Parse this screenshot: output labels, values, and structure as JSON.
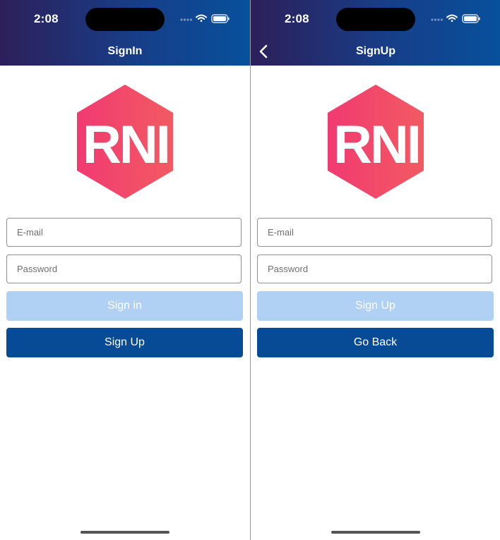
{
  "colors": {
    "header_gradient": [
      "#2d1f5a",
      "#173e88",
      "#07509c"
    ],
    "primary_button_bg": "#b0d1f3",
    "secondary_button_bg": "#074a96",
    "logo_gradient": [
      "#f13a72",
      "#f25a62"
    ]
  },
  "status_bar": {
    "time": "2:08",
    "icons": [
      "signal-dots-icon",
      "wifi-icon",
      "battery-icon"
    ]
  },
  "logo": {
    "text": "RNI"
  },
  "screens": [
    {
      "title": "SignIn",
      "email_placeholder": "E-mail",
      "password_placeholder": "Password",
      "primary_button": "Sign in",
      "secondary_button": "Sign Up"
    },
    {
      "title": "SignUp",
      "back_icon": "chevron-left-icon",
      "email_placeholder": "E-mail",
      "password_placeholder": "Password",
      "primary_button": "Sign Up",
      "secondary_button": "Go Back"
    }
  ]
}
